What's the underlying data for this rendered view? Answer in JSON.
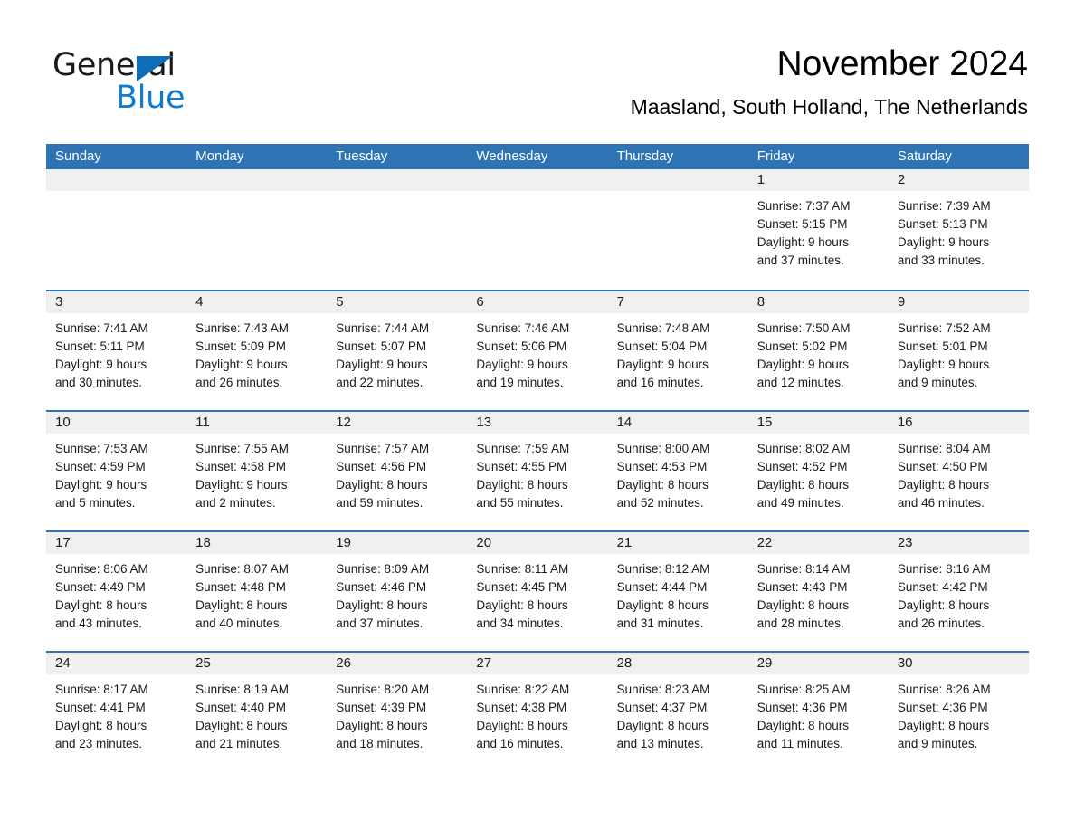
{
  "brand": {
    "name_part1": "General",
    "name_part2": "Blue",
    "accent_color": "#0f7ad1",
    "triangle_color": "#0f6cb5"
  },
  "header": {
    "month_title": "November 2024",
    "location": "Maasland, South Holland, The Netherlands"
  },
  "calendar": {
    "header_color": "#2e74b5",
    "day_band_color": "#f0f0f0",
    "weekday_headers": [
      "Sunday",
      "Monday",
      "Tuesday",
      "Wednesday",
      "Thursday",
      "Friday",
      "Saturday"
    ],
    "weeks": [
      [
        {
          "day": "",
          "sunrise": "",
          "sunset": "",
          "daylight_line1": "",
          "daylight_line2": ""
        },
        {
          "day": "",
          "sunrise": "",
          "sunset": "",
          "daylight_line1": "",
          "daylight_line2": ""
        },
        {
          "day": "",
          "sunrise": "",
          "sunset": "",
          "daylight_line1": "",
          "daylight_line2": ""
        },
        {
          "day": "",
          "sunrise": "",
          "sunset": "",
          "daylight_line1": "",
          "daylight_line2": ""
        },
        {
          "day": "",
          "sunrise": "",
          "sunset": "",
          "daylight_line1": "",
          "daylight_line2": ""
        },
        {
          "day": "1",
          "sunrise": "Sunrise: 7:37 AM",
          "sunset": "Sunset: 5:15 PM",
          "daylight_line1": "Daylight: 9 hours",
          "daylight_line2": "and 37 minutes."
        },
        {
          "day": "2",
          "sunrise": "Sunrise: 7:39 AM",
          "sunset": "Sunset: 5:13 PM",
          "daylight_line1": "Daylight: 9 hours",
          "daylight_line2": "and 33 minutes."
        }
      ],
      [
        {
          "day": "3",
          "sunrise": "Sunrise: 7:41 AM",
          "sunset": "Sunset: 5:11 PM",
          "daylight_line1": "Daylight: 9 hours",
          "daylight_line2": "and 30 minutes."
        },
        {
          "day": "4",
          "sunrise": "Sunrise: 7:43 AM",
          "sunset": "Sunset: 5:09 PM",
          "daylight_line1": "Daylight: 9 hours",
          "daylight_line2": "and 26 minutes."
        },
        {
          "day": "5",
          "sunrise": "Sunrise: 7:44 AM",
          "sunset": "Sunset: 5:07 PM",
          "daylight_line1": "Daylight: 9 hours",
          "daylight_line2": "and 22 minutes."
        },
        {
          "day": "6",
          "sunrise": "Sunrise: 7:46 AM",
          "sunset": "Sunset: 5:06 PM",
          "daylight_line1": "Daylight: 9 hours",
          "daylight_line2": "and 19 minutes."
        },
        {
          "day": "7",
          "sunrise": "Sunrise: 7:48 AM",
          "sunset": "Sunset: 5:04 PM",
          "daylight_line1": "Daylight: 9 hours",
          "daylight_line2": "and 16 minutes."
        },
        {
          "day": "8",
          "sunrise": "Sunrise: 7:50 AM",
          "sunset": "Sunset: 5:02 PM",
          "daylight_line1": "Daylight: 9 hours",
          "daylight_line2": "and 12 minutes."
        },
        {
          "day": "9",
          "sunrise": "Sunrise: 7:52 AM",
          "sunset": "Sunset: 5:01 PM",
          "daylight_line1": "Daylight: 9 hours",
          "daylight_line2": "and 9 minutes."
        }
      ],
      [
        {
          "day": "10",
          "sunrise": "Sunrise: 7:53 AM",
          "sunset": "Sunset: 4:59 PM",
          "daylight_line1": "Daylight: 9 hours",
          "daylight_line2": "and 5 minutes."
        },
        {
          "day": "11",
          "sunrise": "Sunrise: 7:55 AM",
          "sunset": "Sunset: 4:58 PM",
          "daylight_line1": "Daylight: 9 hours",
          "daylight_line2": "and 2 minutes."
        },
        {
          "day": "12",
          "sunrise": "Sunrise: 7:57 AM",
          "sunset": "Sunset: 4:56 PM",
          "daylight_line1": "Daylight: 8 hours",
          "daylight_line2": "and 59 minutes."
        },
        {
          "day": "13",
          "sunrise": "Sunrise: 7:59 AM",
          "sunset": "Sunset: 4:55 PM",
          "daylight_line1": "Daylight: 8 hours",
          "daylight_line2": "and 55 minutes."
        },
        {
          "day": "14",
          "sunrise": "Sunrise: 8:00 AM",
          "sunset": "Sunset: 4:53 PM",
          "daylight_line1": "Daylight: 8 hours",
          "daylight_line2": "and 52 minutes."
        },
        {
          "day": "15",
          "sunrise": "Sunrise: 8:02 AM",
          "sunset": "Sunset: 4:52 PM",
          "daylight_line1": "Daylight: 8 hours",
          "daylight_line2": "and 49 minutes."
        },
        {
          "day": "16",
          "sunrise": "Sunrise: 8:04 AM",
          "sunset": "Sunset: 4:50 PM",
          "daylight_line1": "Daylight: 8 hours",
          "daylight_line2": "and 46 minutes."
        }
      ],
      [
        {
          "day": "17",
          "sunrise": "Sunrise: 8:06 AM",
          "sunset": "Sunset: 4:49 PM",
          "daylight_line1": "Daylight: 8 hours",
          "daylight_line2": "and 43 minutes."
        },
        {
          "day": "18",
          "sunrise": "Sunrise: 8:07 AM",
          "sunset": "Sunset: 4:48 PM",
          "daylight_line1": "Daylight: 8 hours",
          "daylight_line2": "and 40 minutes."
        },
        {
          "day": "19",
          "sunrise": "Sunrise: 8:09 AM",
          "sunset": "Sunset: 4:46 PM",
          "daylight_line1": "Daylight: 8 hours",
          "daylight_line2": "and 37 minutes."
        },
        {
          "day": "20",
          "sunrise": "Sunrise: 8:11 AM",
          "sunset": "Sunset: 4:45 PM",
          "daylight_line1": "Daylight: 8 hours",
          "daylight_line2": "and 34 minutes."
        },
        {
          "day": "21",
          "sunrise": "Sunrise: 8:12 AM",
          "sunset": "Sunset: 4:44 PM",
          "daylight_line1": "Daylight: 8 hours",
          "daylight_line2": "and 31 minutes."
        },
        {
          "day": "22",
          "sunrise": "Sunrise: 8:14 AM",
          "sunset": "Sunset: 4:43 PM",
          "daylight_line1": "Daylight: 8 hours",
          "daylight_line2": "and 28 minutes."
        },
        {
          "day": "23",
          "sunrise": "Sunrise: 8:16 AM",
          "sunset": "Sunset: 4:42 PM",
          "daylight_line1": "Daylight: 8 hours",
          "daylight_line2": "and 26 minutes."
        }
      ],
      [
        {
          "day": "24",
          "sunrise": "Sunrise: 8:17 AM",
          "sunset": "Sunset: 4:41 PM",
          "daylight_line1": "Daylight: 8 hours",
          "daylight_line2": "and 23 minutes."
        },
        {
          "day": "25",
          "sunrise": "Sunrise: 8:19 AM",
          "sunset": "Sunset: 4:40 PM",
          "daylight_line1": "Daylight: 8 hours",
          "daylight_line2": "and 21 minutes."
        },
        {
          "day": "26",
          "sunrise": "Sunrise: 8:20 AM",
          "sunset": "Sunset: 4:39 PM",
          "daylight_line1": "Daylight: 8 hours",
          "daylight_line2": "and 18 minutes."
        },
        {
          "day": "27",
          "sunrise": "Sunrise: 8:22 AM",
          "sunset": "Sunset: 4:38 PM",
          "daylight_line1": "Daylight: 8 hours",
          "daylight_line2": "and 16 minutes."
        },
        {
          "day": "28",
          "sunrise": "Sunrise: 8:23 AM",
          "sunset": "Sunset: 4:37 PM",
          "daylight_line1": "Daylight: 8 hours",
          "daylight_line2": "and 13 minutes."
        },
        {
          "day": "29",
          "sunrise": "Sunrise: 8:25 AM",
          "sunset": "Sunset: 4:36 PM",
          "daylight_line1": "Daylight: 8 hours",
          "daylight_line2": "and 11 minutes."
        },
        {
          "day": "30",
          "sunrise": "Sunrise: 8:26 AM",
          "sunset": "Sunset: 4:36 PM",
          "daylight_line1": "Daylight: 8 hours",
          "daylight_line2": "and 9 minutes."
        }
      ]
    ]
  }
}
